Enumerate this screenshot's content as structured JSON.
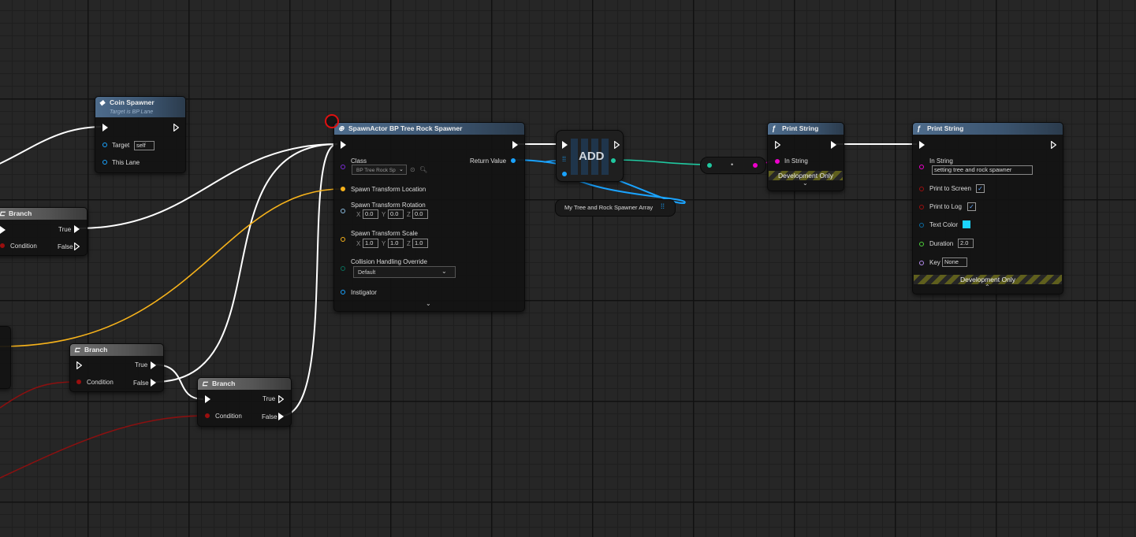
{
  "colors": {
    "exec": "#ffffff",
    "object": "#1aa3ff",
    "vector": "#f6b21b",
    "bool": "#9b0f0f",
    "string": "#ee00cc",
    "struct_dark": "#0b6aa0",
    "array_ref": "#20c8a0"
  },
  "coin_spawner": {
    "title": "Coin Spawner",
    "subtitle": "Target is BP Lane",
    "target_label": "Target",
    "target_value": "self",
    "this_lane_label": "This Lane"
  },
  "branches": [
    {
      "title": "Branch",
      "true_label": "True",
      "false_label": "False",
      "condition_label": "Condition"
    },
    {
      "title": "Branch",
      "true_label": "True",
      "false_label": "False",
      "condition_label": "Condition"
    },
    {
      "title": "Branch",
      "true_label": "True",
      "false_label": "False",
      "condition_label": "Condition"
    }
  ],
  "spawn_actor": {
    "title": "SpawnActor BP Tree Rock Spawner",
    "class_label": "Class",
    "class_value": "BP Tree Rock Sp",
    "return_label": "Return Value",
    "location_label": "Spawn Transform Location",
    "rotation_label": "Spawn Transform Rotation",
    "rotation": {
      "x": "0.0",
      "y": "0.0",
      "z": "0.0"
    },
    "scale_label": "Spawn Transform Scale",
    "scale": {
      "x": "1.0",
      "y": "1.0",
      "z": "1.0"
    },
    "axis_x": "X",
    "axis_y": "Y",
    "axis_z": "Z",
    "collision_label": "Collision Handling Override",
    "collision_value": "Default",
    "instigator_label": "Instigator"
  },
  "add_node": {
    "label": "ADD"
  },
  "array_var": {
    "label": "My Tree and Rock Spawner Array"
  },
  "print_string_1": {
    "title": "Print String",
    "in_string_label": "In String",
    "dev_only": "Development Only"
  },
  "print_string_2": {
    "title": "Print String",
    "in_string_label": "In String",
    "in_string_value": "setting tree and rock spawner",
    "print_screen_label": "Print to Screen",
    "print_log_label": "Print to Log",
    "text_color_label": "Text Color",
    "duration_label": "Duration",
    "duration_value": "2.0",
    "key_label": "Key",
    "key_value": "None",
    "dev_only": "Development Only"
  }
}
